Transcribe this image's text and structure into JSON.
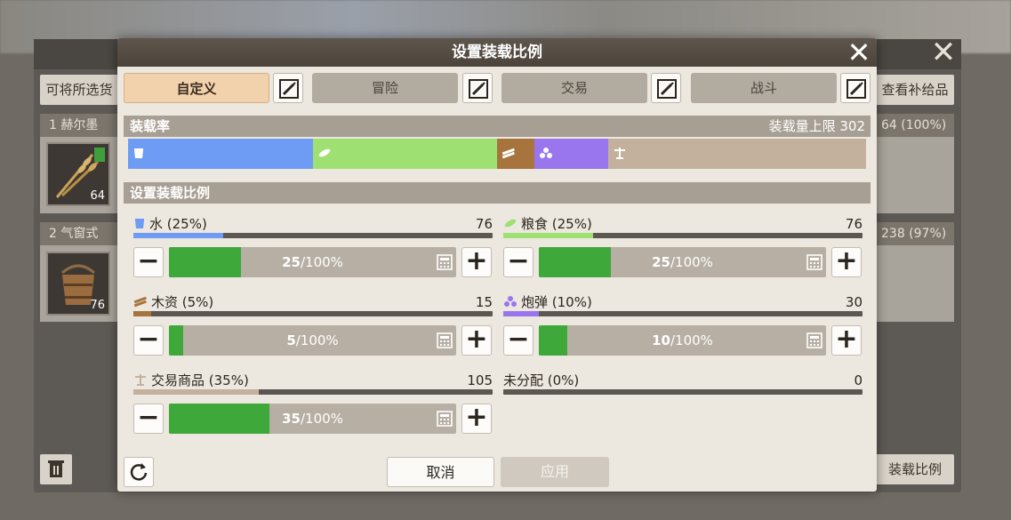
{
  "background": {
    "left_button": "可将所选货",
    "right_button": "查看补给品",
    "rows": [
      {
        "label": "1  赫尔墨",
        "right": "64 (100%)",
        "slot_count": "64"
      },
      {
        "label": "2  气窗式",
        "right": "238 (97%)",
        "slot_count": "76"
      }
    ],
    "bottom_right_button": "装载比例"
  },
  "dialog": {
    "title": "设置装载比例",
    "presets": [
      {
        "label": "自定义",
        "active": true
      },
      {
        "label": "冒险",
        "active": false
      },
      {
        "label": "交易",
        "active": false
      },
      {
        "label": "战斗",
        "active": false
      }
    ],
    "load_rate": {
      "title": "装载率",
      "capacity_label": "装载量上限 302",
      "segments": [
        {
          "name": "water",
          "percent": 25,
          "color": "#6e9cf5",
          "icon": "bucket-icon"
        },
        {
          "name": "food",
          "percent": 25,
          "color": "#9fe072",
          "icon": "grain-icon"
        },
        {
          "name": "wood",
          "percent": 5,
          "color": "#a6743c",
          "icon": "wood-icon"
        },
        {
          "name": "cannonball",
          "percent": 10,
          "color": "#9a76ee",
          "icon": "cannonball-icon"
        },
        {
          "name": "trade",
          "percent": 35,
          "color": "#c3b19e",
          "icon": "scale-icon"
        }
      ]
    },
    "ratio_section_title": "设置装载比例",
    "resources": [
      {
        "key": "water",
        "label": "水 (25%)",
        "amount": "76",
        "fill_percent": 25,
        "color": "#6e9cf5",
        "step_value": "25",
        "step_max": "/100%",
        "icon": "bucket-icon"
      },
      {
        "key": "food",
        "label": "粮食 (25%)",
        "amount": "76",
        "fill_percent": 25,
        "color": "#9fe072",
        "step_value": "25",
        "step_max": "/100%",
        "icon": "grain-icon"
      },
      {
        "key": "wood",
        "label": "木资 (5%)",
        "amount": "15",
        "fill_percent": 5,
        "color": "#a6743c",
        "step_value": "5",
        "step_max": "/100%",
        "icon": "wood-icon"
      },
      {
        "key": "cannonball",
        "label": "炮弹 (10%)",
        "amount": "30",
        "fill_percent": 10,
        "color": "#9a76ee",
        "step_value": "10",
        "step_max": "/100%",
        "icon": "cannonball-icon"
      },
      {
        "key": "trade",
        "label": "交易商品 (35%)",
        "amount": "105",
        "fill_percent": 35,
        "color": "#c3b19e",
        "step_value": "35",
        "step_max": "/100%",
        "icon": "scale-icon"
      }
    ],
    "unallocated": {
      "label": "未分配 (0%)",
      "amount": "0"
    },
    "cancel_label": "取消",
    "apply_label": "应用"
  }
}
